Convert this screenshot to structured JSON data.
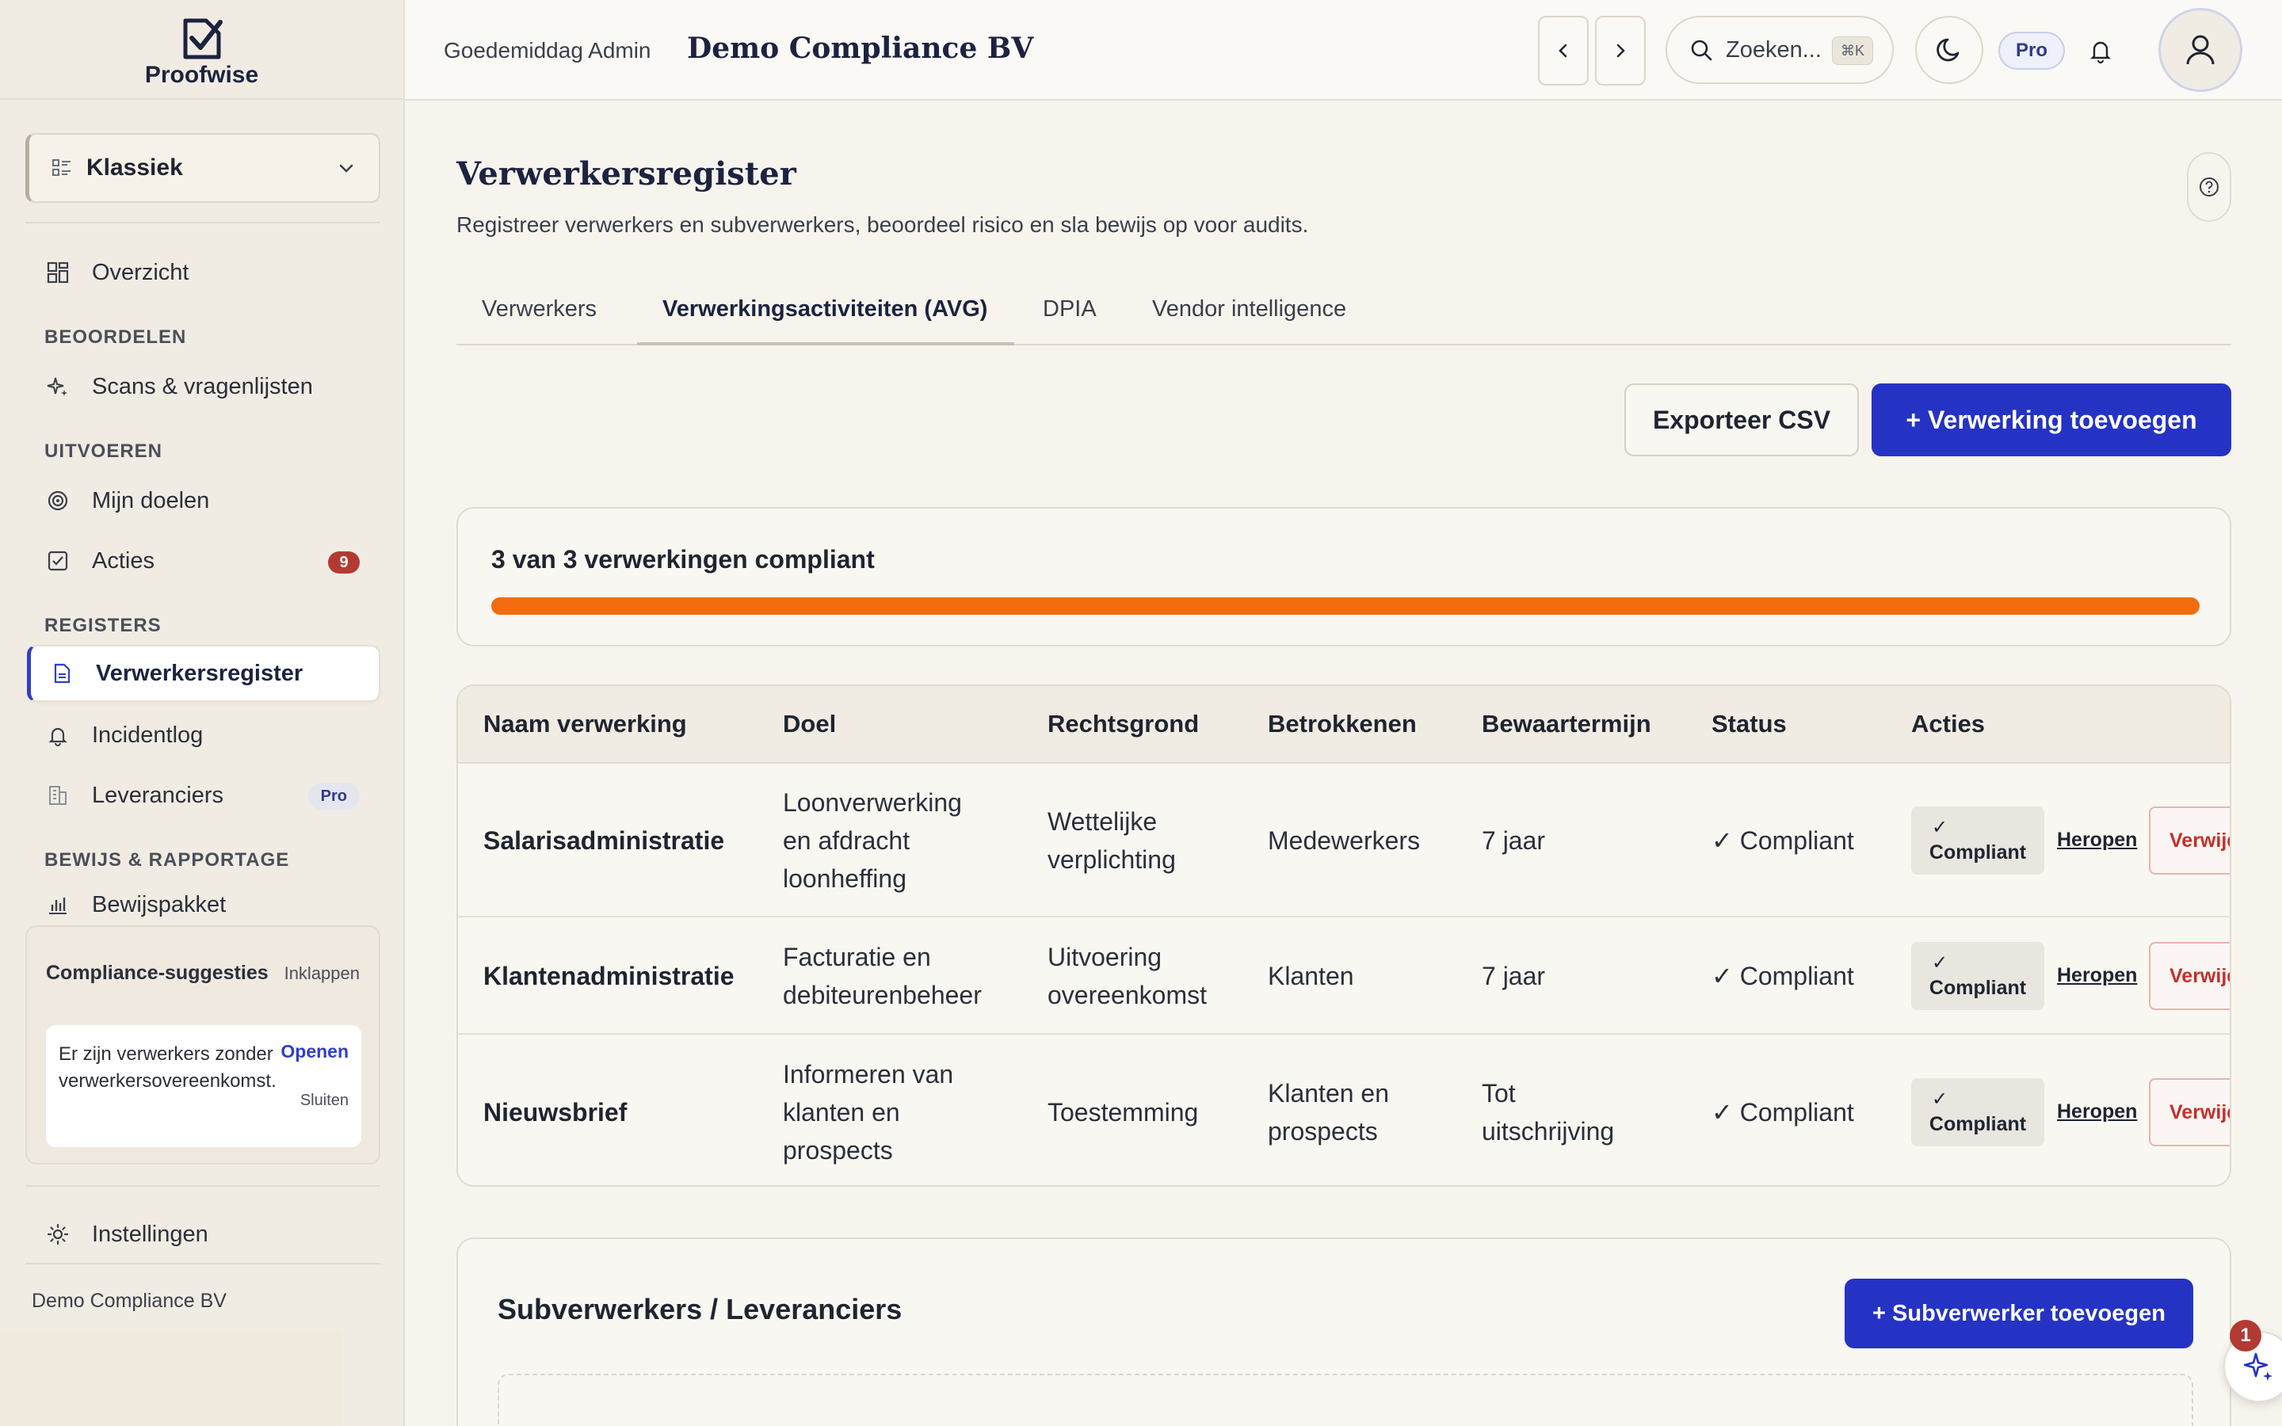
{
  "brand": {
    "name": "Proofwise"
  },
  "sidebar": {
    "layout_select": "Klassiek",
    "overview": "Overzicht",
    "sections": {
      "assess": "BEOORDELEN",
      "execute": "UITVOEREN",
      "registers": "REGISTERS",
      "evidence": "BEWIJS & RAPPORTAGE"
    },
    "items": {
      "scans": "Scans & vragenlijsten",
      "goals": "Mijn doelen",
      "actions": "Acties",
      "actions_count": "9",
      "processors": "Verwerkersregister",
      "incidents": "Incidentlog",
      "suppliers": "Leveranciers",
      "suppliers_badge": "Pro",
      "evidence": "Bewijspakket",
      "settings": "Instellingen"
    },
    "suggestions": {
      "title": "Compliance-suggesties",
      "collapse": "Inklappen",
      "text": "Er zijn verwerkers zonder verwerkersovereenkomst.",
      "open": "Openen",
      "close": "Sluiten"
    },
    "org": "Demo Compliance BV"
  },
  "topbar": {
    "greeting": "Goedemiddag Admin",
    "company": "Demo Compliance BV",
    "search_placeholder": "Zoeken...",
    "search_shortcut": "⌘K",
    "pro": "Pro"
  },
  "page": {
    "title": "Verwerkersregister",
    "subtitle": "Registreer verwerkers en subverwerkers, beoordeel risico en sla bewijs op voor audits.",
    "tabs": [
      "Verwerkers",
      "Verwerkingsactiviteiten (AVG)",
      "DPIA",
      "Vendor intelligence"
    ],
    "active_tab": 1,
    "export_btn": "Exporteer CSV",
    "add_btn": "+ Verwerking toevoegen"
  },
  "progress": {
    "label": "3 van 3 verwerkingen compliant",
    "fraction": 1.0
  },
  "table": {
    "headers": [
      "Naam verwerking",
      "Doel",
      "Rechtsgrond",
      "Betrokkenen",
      "Bewaartermijn",
      "Status",
      "Acties"
    ],
    "rows": [
      {
        "name": "Salarisadministratie",
        "purpose": [
          "Loonverwerking",
          "en afdracht",
          "loonheffing"
        ],
        "basis": [
          "Wettelijke",
          "verplichting"
        ],
        "subjects": [
          "Medewerkers"
        ],
        "retention": [
          "7 jaar"
        ],
        "status": "✓ Compliant"
      },
      {
        "name": "Klantenadministratie",
        "purpose": [
          "Facturatie en",
          "debiteurenbeheer"
        ],
        "basis": [
          "Uitvoering",
          "overeenkomst"
        ],
        "subjects": [
          "Klanten"
        ],
        "retention": [
          "7 jaar"
        ],
        "status": "✓ Compliant"
      },
      {
        "name": "Nieuwsbrief",
        "purpose": [
          "Informeren van",
          "klanten en",
          "prospects"
        ],
        "basis": [
          "Toestemming"
        ],
        "subjects": [
          "Klanten en",
          "prospects"
        ],
        "retention": [
          "Tot",
          "uitschrijving"
        ],
        "status": "✓ Compliant"
      }
    ],
    "chip_check": "✓",
    "chip_label": "Compliant",
    "reopen": "Heropen",
    "delete": "Verwijderen"
  },
  "subprocessors": {
    "title": "Subverwerkers / Leveranciers",
    "add_btn": "+ Subverwerker toevoegen"
  },
  "fab": {
    "badge": "1"
  }
}
